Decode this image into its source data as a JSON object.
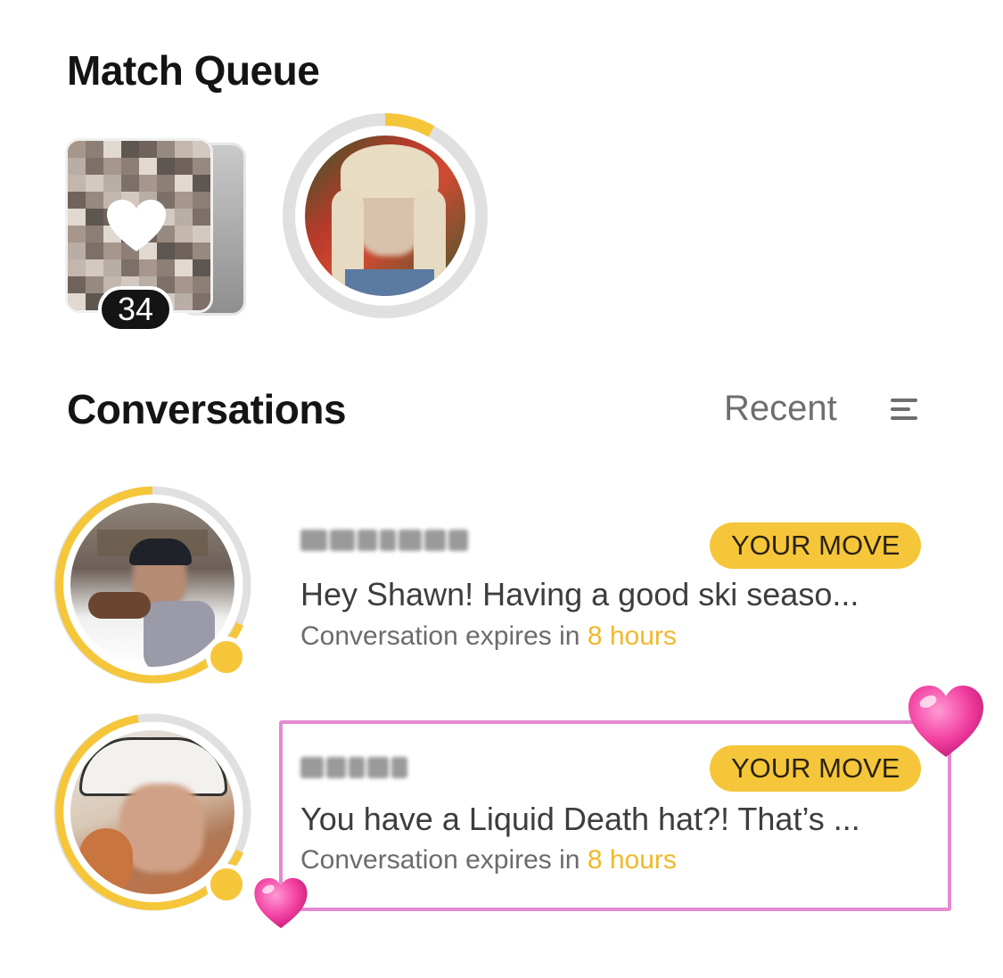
{
  "match_queue": {
    "title": "Match Queue",
    "count": "34",
    "progress": 0.08
  },
  "conversations": {
    "title": "Conversations",
    "sort_label": "Recent",
    "items": [
      {
        "preview": "Hey Shawn! Having a good ski seaso...",
        "badge": "YOUR MOVE",
        "expires_prefix": "Conversation expires in ",
        "expires_value": "8 hours"
      },
      {
        "preview": "You have a Liquid Death hat?! That’s ...",
        "badge": "YOUR MOVE",
        "expires_prefix": "Conversation expires in ",
        "expires_value": "8 hours"
      }
    ]
  },
  "colors": {
    "accent": "#f6c63a",
    "ring_track": "#e0e0e0",
    "highlight": "#e48ad0",
    "heart_pink": "#f23fa0"
  }
}
